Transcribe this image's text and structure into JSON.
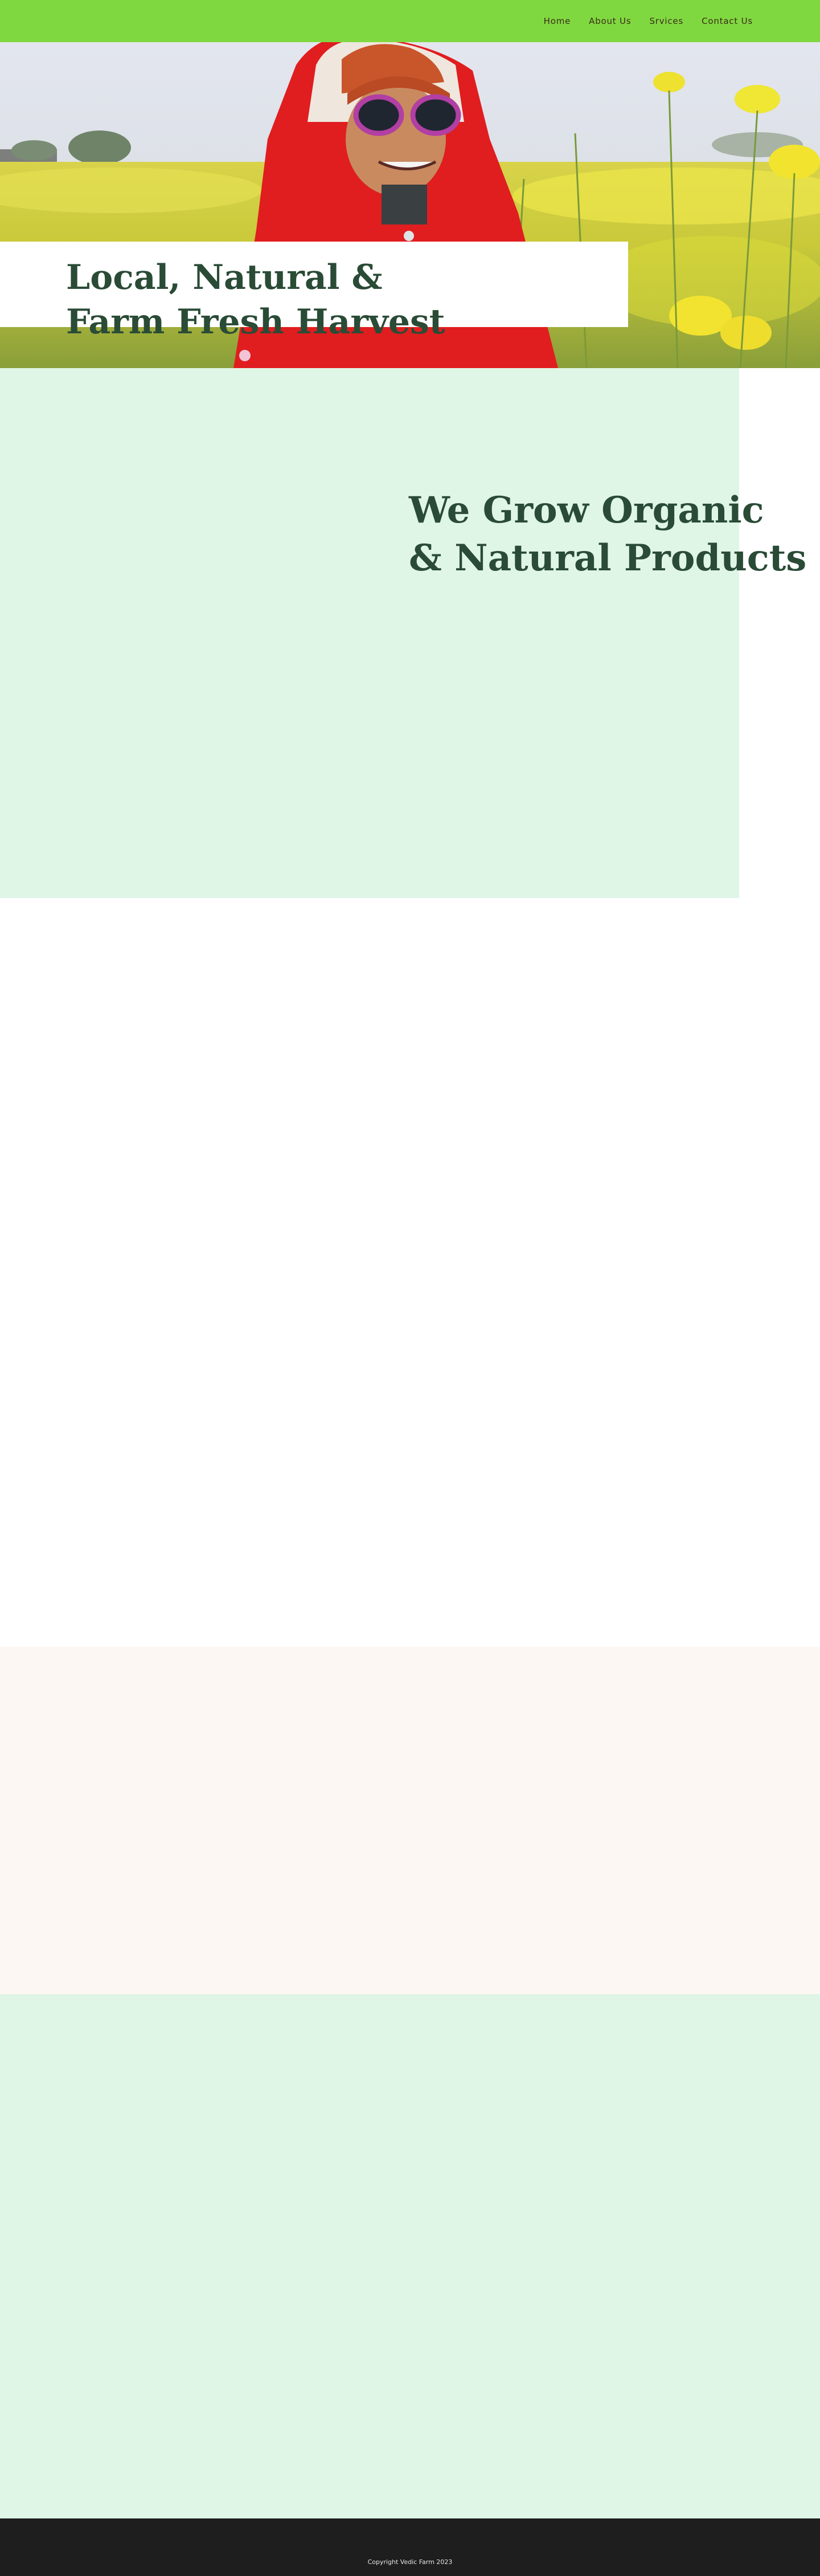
{
  "nav": {
    "items": [
      {
        "label": "Home"
      },
      {
        "label": "About Us"
      },
      {
        "label": "Srvices"
      },
      {
        "label": "Contact Us"
      }
    ]
  },
  "hero": {
    "title_line1": "Local, Natural &",
    "title_line2": "Farm Fresh Harvest"
  },
  "organic": {
    "title_line1": "We Grow Organic",
    "title_line2": "& Natural Products"
  },
  "footer": {
    "copyright": "Copyright Vedic Farm 2023"
  },
  "colors": {
    "nav_bg": "#80d841",
    "heading": "#2a4b36",
    "mint_bg": "#dff5e6",
    "peach_bg": "#fdf7f4",
    "footer_bg": "#1e1e1e"
  }
}
